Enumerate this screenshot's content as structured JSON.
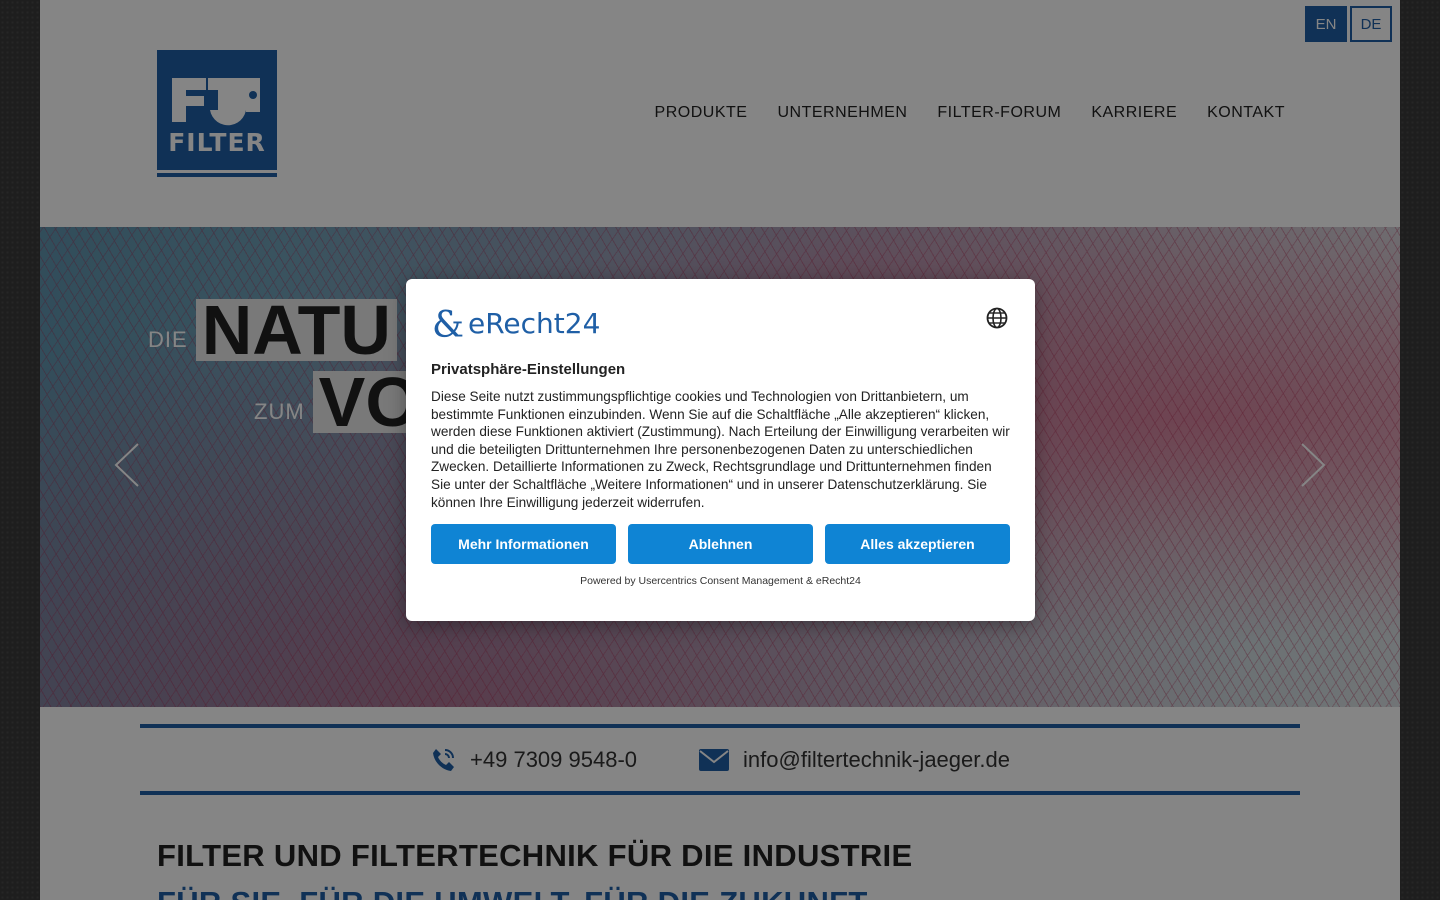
{
  "header": {
    "languages": [
      {
        "code": "EN",
        "active": true
      },
      {
        "code": "DE",
        "active": false
      }
    ],
    "logo_text": "FILTER",
    "nav": [
      {
        "label": "PRODUKTE"
      },
      {
        "label": "UNTERNEHMEN"
      },
      {
        "label": "FILTER-FORUM"
      },
      {
        "label": "KARRIERE"
      },
      {
        "label": "KONTAKT"
      }
    ]
  },
  "hero": {
    "line1_small": "DIE",
    "line1_big": "NATU",
    "line2_small": "ZUM",
    "line2_big": "VO"
  },
  "contact": {
    "phone": "+49 7309 9548-0",
    "email": "info@filtertechnik-jaeger.de"
  },
  "content": {
    "heading": "FILTER UND FILTERTECHNIK FÜR DIE INDUSTRIE",
    "subheading": "FÜR SIE. FÜR DIE UMWELT. FÜR DIE ZUKUNFT."
  },
  "consent": {
    "brand": "eRecht24",
    "title": "Privatsphäre-Einstellungen",
    "body": "Diese Seite nutzt zustimmungspflichtige cookies und Technologien von Drittanbietern, um bestimmte Funktionen einzubinden. Wenn Sie auf die Schaltfläche „Alle akzeptieren“ klicken, werden diese Funktionen aktiviert (Zustimmung). Nach Erteilung der Einwilligung verarbeiten wir und die beteiligten Drittunternehmen Ihre personenbezogenen Daten zu unterschiedlichen Zwecken. Detaillierte Informationen zu Zweck, Rechtsgrundlage und Drittunternehmen finden Sie unter der Schaltfläche „Weitere Informationen“ und in unserer Datenschutzerklärung. Sie können Ihre Einwilligung jederzeit widerrufen.",
    "buttons": {
      "more": "Mehr Informationen",
      "decline": "Ablehnen",
      "accept": "Alles akzeptieren"
    },
    "powered_by": "Powered by Usercentrics Consent Management & eRecht24"
  },
  "colors": {
    "brand_blue": "#1f5fa6",
    "button_blue": "#0f84d4",
    "overlay": "rgba(0,0,0,0.48)"
  },
  "icons": [
    "phone-icon",
    "mail-icon",
    "globe-icon",
    "chevron-left-icon",
    "chevron-right-icon",
    "erecht24-logo-icon"
  ]
}
